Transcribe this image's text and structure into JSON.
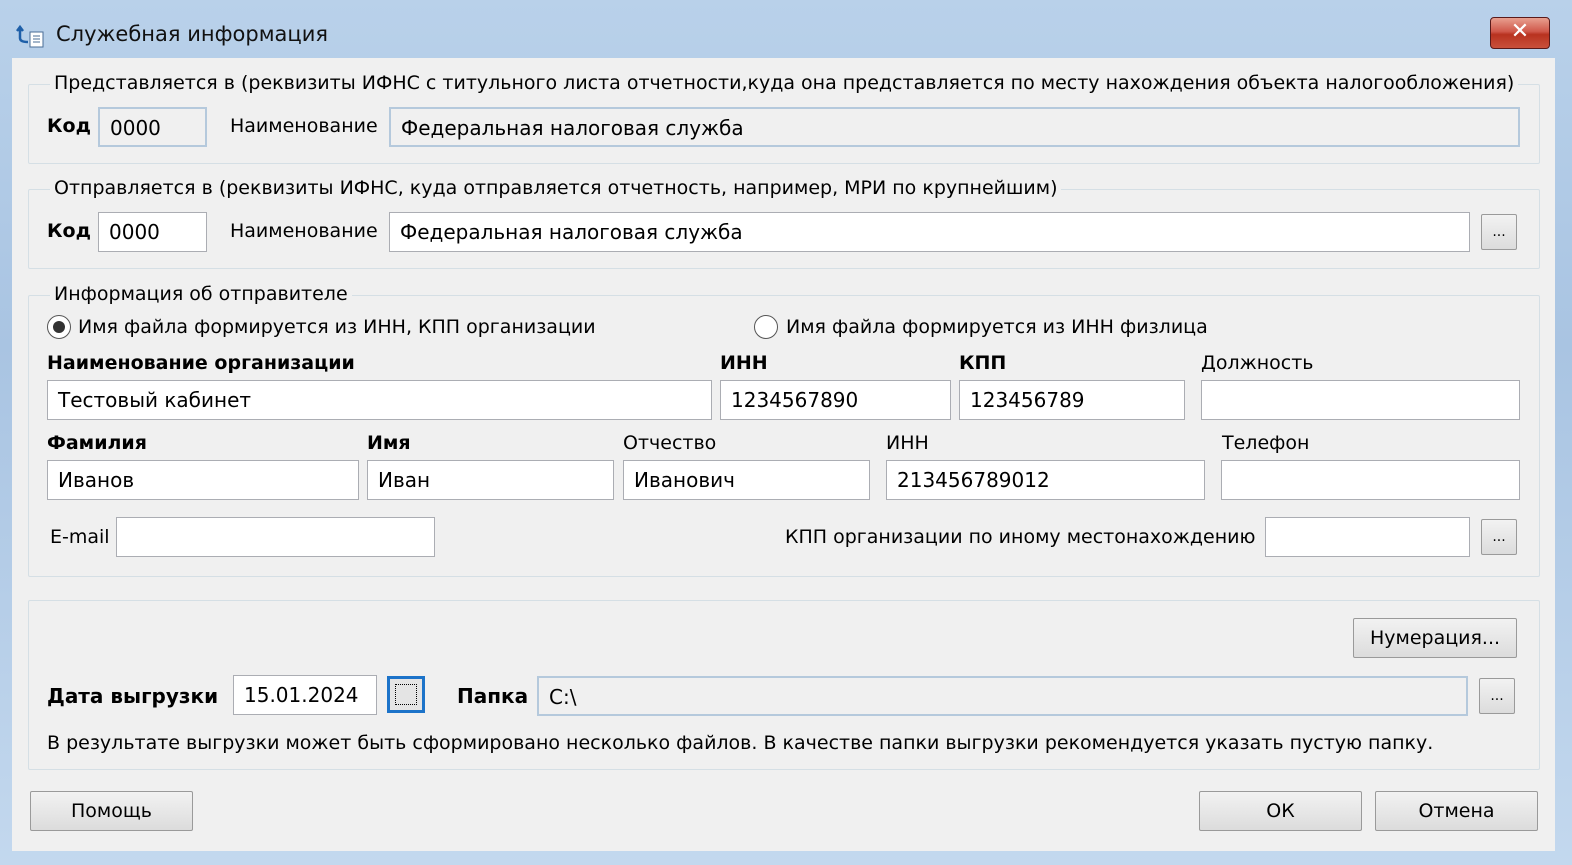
{
  "window": {
    "title": "Служебная информация",
    "close_label": "✕",
    "icon": "app-tree-icon"
  },
  "presented": {
    "legend": "Представляется в (реквизиты ИФНС с титульного листа отчетности,куда она представляется по месту нахождения объекта налогообложения)",
    "code_label": "Код",
    "code": "0000",
    "name_label": "Наименование",
    "name": "Федеральная налоговая служба"
  },
  "sent": {
    "legend": "Отправляется в (реквизиты ИФНС, куда отправляется отчетность, например, МРИ по крупнейшим)",
    "code_label": "Код",
    "code": "0000",
    "name_label": "Наименование",
    "name": "Федеральная налоговая служба",
    "browse": "..."
  },
  "sender": {
    "legend": "Информация об отправителе",
    "radio_org": "Имя файла формируется из ИНН, КПП организации",
    "radio_org_selected": true,
    "radio_person": "Имя файла формируется из ИНН физлица",
    "org_name_label": "Наименование организации",
    "org_name": "Тестовый кабинет",
    "inn_label": "ИНН",
    "inn": "1234567890",
    "kpp_label": "КПП",
    "kpp": "123456789",
    "position_label": "Должность",
    "position": "",
    "surname_label": "Фамилия",
    "surname": "Иванов",
    "first_name_label": "Имя",
    "first_name": "Иван",
    "patronymic_label": "Отчество",
    "patronymic": "Иванович",
    "person_inn_label": "ИНН",
    "person_inn": "213456789012",
    "phone_label": "Телефон",
    "phone": "",
    "email_label": "E-mail",
    "email": "",
    "other_kpp_label": "КПП организации по иному местонахождению",
    "other_kpp": "",
    "browse": "..."
  },
  "export": {
    "numbering_button": "Нумерация...",
    "date_label": "Дата выгрузки",
    "date": "15.01.2024",
    "folder_label": "Папка",
    "folder": "C:\\",
    "browse": "...",
    "note": "В результате выгрузки может быть сформировано несколько файлов. В качестве папки выгрузки рекомендуется указать пустую папку."
  },
  "buttons": {
    "help": "Помощь",
    "ok": "ОК",
    "cancel": "Отмена"
  }
}
